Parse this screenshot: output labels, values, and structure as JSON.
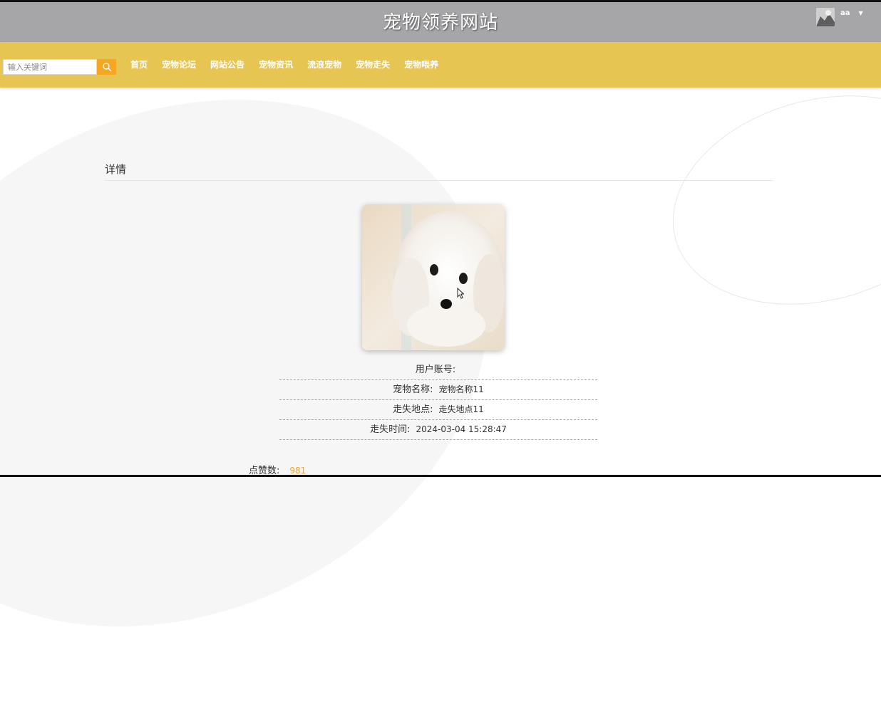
{
  "header": {
    "site_title": "宠物领养网站",
    "username": "aa"
  },
  "search": {
    "placeholder": "输入关键词",
    "value": ""
  },
  "nav": {
    "items": [
      {
        "label": "首页"
      },
      {
        "label": "宠物论坛"
      },
      {
        "label": "网站公告"
      },
      {
        "label": "宠物资讯"
      },
      {
        "label": "流浪宠物"
      },
      {
        "label": "宠物走失"
      },
      {
        "label": "宠物喂养"
      }
    ]
  },
  "detail": {
    "section_title": "详情",
    "fields": [
      {
        "label": "用户账号:",
        "value": ""
      },
      {
        "label": "宠物名称:",
        "value": "宠物名称11"
      },
      {
        "label": "走失地点:",
        "value": "走失地点11"
      },
      {
        "label": "走失时间:",
        "value": "2024-03-04 15:28:47"
      }
    ],
    "likes_label": "点赞数:",
    "likes_value": "981"
  },
  "colors": {
    "header_bg": "#a6a6a8",
    "nav_bg": "#e6c552",
    "accent": "#f5a623",
    "divider": "#e0a33a"
  },
  "icons": {
    "search_button": "search-icon",
    "user_menu": "caret-down-icon"
  }
}
